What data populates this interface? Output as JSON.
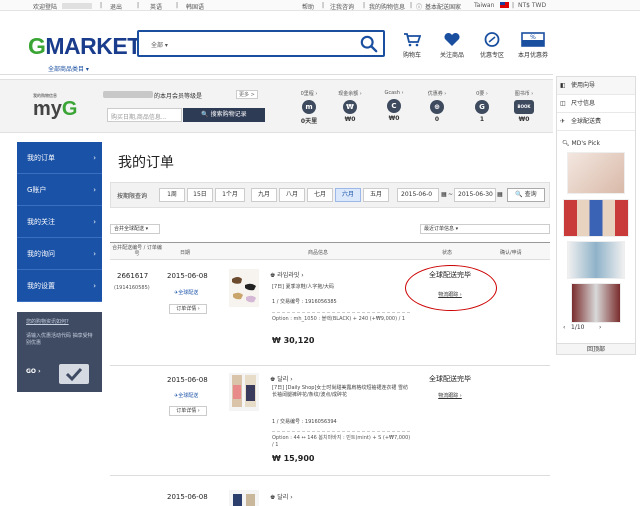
{
  "topbar": {
    "welcome": "欢迎登陆",
    "logout": "退出",
    "lang_en": "英语",
    "lang_kr": "韩国语",
    "help": "帮助",
    "faq": "注我咨询",
    "my_shop": "我的购物信息",
    "region_settings": "基本配送国家",
    "country": "Taiwan",
    "currency": "NT$ TWD"
  },
  "header": {
    "logo_g": "G",
    "logo_rest": "MARKET",
    "all_categories": "全部商品类目 ▾",
    "search_category": "全部 ▾",
    "icons": [
      "购物车",
      "关注商品",
      "优惠专区",
      "本月优惠券"
    ]
  },
  "myg": {
    "tagline": "我的购物信息",
    "logo_my": "my",
    "logo_g": "G",
    "member_msg": "的本月会员等级是",
    "more": "更多 >",
    "search_placeholder": "购买日期,商品信息...",
    "search_button": "🔍 搜索购物记录",
    "stats": [
      {
        "label": "0里程 ›",
        "icon": "m",
        "value": "0天里"
      },
      {
        "label": "现金余额 ›",
        "icon": "₩",
        "value": "₩0"
      },
      {
        "label": "Gcash ›",
        "icon": "C",
        "value": "₩0"
      },
      {
        "label": "优惠券 ›",
        "icon": "⊕",
        "value": "0"
      },
      {
        "label": "0要 ›",
        "icon": "G",
        "value": "1"
      },
      {
        "label": "图书币 ›",
        "icon": "BOOK",
        "value": "₩0"
      }
    ]
  },
  "right_panel": {
    "items": [
      "使用向导",
      "尺寸信息",
      "全球配送费"
    ],
    "md_pick": "MD's Pick",
    "pager": "1/10",
    "to_top": "回顶部"
  },
  "sidebar": {
    "items": [
      "我的订单",
      "G账户",
      "我的关注",
      "我的询问",
      "我的设置"
    ],
    "promo_title": "您的购物资讯如何?",
    "promo_text": "请输入优惠活动代码 抽享受特别优惠",
    "go": "GO ›"
  },
  "page": {
    "title": "我的订单",
    "filter_label": "按期限查询",
    "periods": [
      "1周",
      "15日",
      "1个月",
      "九月",
      "八月",
      "七月",
      "六月",
      "五月"
    ],
    "selected_period": "六月",
    "date_from": "2015-06-0",
    "date_sep": "~",
    "date_to": "2015-06-30",
    "query_button": "🔍 查询",
    "ship_filter": "合并全球配送 ▾",
    "sort_filter": "最近订单信息 ▾",
    "columns": [
      "合并配送编号 / 订单编号",
      "日期",
      "商品信息",
      "状态",
      "确认/申请"
    ]
  },
  "orders": [
    {
      "order_no": "2661617",
      "sub_no": "(1914160585)",
      "date": "2015-06-08",
      "ship": "✈全球配送",
      "detail": "订单详情 ›",
      "shop": "♚ 라임라잇 ›",
      "name": "[7日] 夏季凉鞋/人字拖/大码",
      "code": "1 / 交易编号 : 1916056385",
      "option": "Option : mh_1050 : 블랙(BLACK) + 240 (+₩9,000) / 1",
      "price": "₩ 30,120",
      "status": "全球配送完毕",
      "track": "物流跟踪 ›"
    },
    {
      "order_no": "",
      "sub_no": "",
      "date": "2015-06-08",
      "ship": "✈全球配送",
      "detail": "订单详情 ›",
      "shop": "♚ 달리 ›",
      "name": "[7日] [Daily Shop]女士时尚甜美露肩格纹短袖裙连衣裙 雪纺长袖阔腿裤碎花/条纹/波点/成碎花",
      "code": "1 / 交易编号 : 1916056394",
      "option": "Option : 44 ↔ 146 봄치마바지 : 민트(mint) + S (+₩7,000) / 1",
      "price": "₩ 15,900",
      "status": "全球配送完毕",
      "track": "物流跟踪 ›"
    },
    {
      "order_no": "",
      "sub_no": "",
      "date": "2015-06-08",
      "shop": "♚ 달리 ›",
      "name": "",
      "code": "",
      "option": "",
      "price": "",
      "status": "",
      "track": ""
    }
  ]
}
